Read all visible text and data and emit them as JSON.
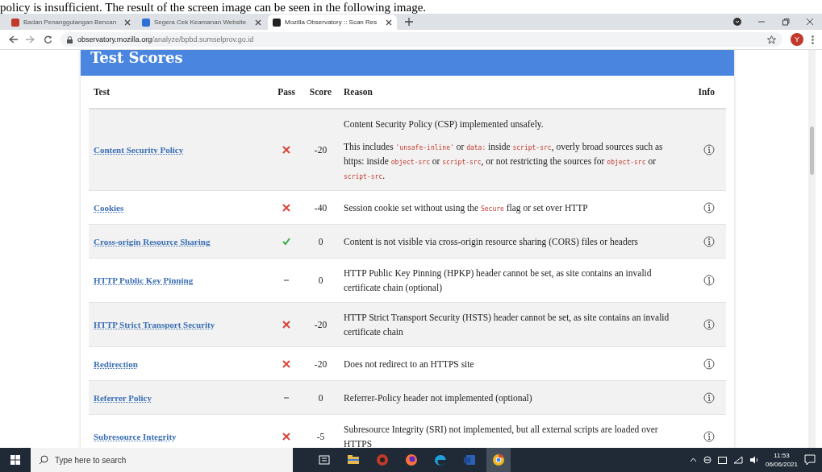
{
  "document_text": "policy is insufficient. The result of the screen image can be seen in the following image.",
  "tabs": [
    {
      "title": "Badan Penanggulangan Bencan",
      "color": "#c0392b",
      "selected": false
    },
    {
      "title": "Segera Cek Keamanan Website",
      "color": "#2f6fd6",
      "selected": false
    },
    {
      "title": "Mozilla Observatory :: Scan Res",
      "color": "#222222",
      "selected": true
    }
  ],
  "address_bar": {
    "host": "observatory.mozilla.org",
    "path": "/analyze/bpbd.sumselprov.go.id"
  },
  "profile_initial": "Y",
  "section_title": "Test Scores",
  "columns": [
    "Test",
    "Pass",
    "Score",
    "Reason",
    "Info"
  ],
  "rows": [
    {
      "test": "Content Security Policy",
      "kind": "fail",
      "score": "-20",
      "reason": [
        [
          {
            "kind": "text",
            "text": "Content Security Policy (CSP) implemented unsafely."
          }
        ],
        [
          {
            "kind": "text",
            "text": "This includes "
          },
          {
            "kind": "code",
            "text": "'unsafe-inline'"
          },
          {
            "kind": "text",
            "text": " or "
          },
          {
            "kind": "code",
            "text": "data:"
          },
          {
            "kind": "text",
            "text": " inside "
          },
          {
            "kind": "code",
            "text": "script-src"
          },
          {
            "kind": "text",
            "text": ", overly broad sources such as https: inside "
          },
          {
            "kind": "code",
            "text": "object-src"
          },
          {
            "kind": "text",
            "text": " or "
          },
          {
            "kind": "code",
            "text": "script-src"
          },
          {
            "kind": "text",
            "text": ", or not restricting the sources for "
          },
          {
            "kind": "code",
            "text": "object-src"
          },
          {
            "kind": "text",
            "text": " or "
          },
          {
            "kind": "code",
            "text": "script-src"
          },
          {
            "kind": "text",
            "text": "."
          }
        ]
      ]
    },
    {
      "test": "Cookies",
      "kind": "fail",
      "score": "-40",
      "reason": [
        [
          {
            "kind": "text",
            "text": "Session cookie set without using the "
          },
          {
            "kind": "code",
            "text": "Secure"
          },
          {
            "kind": "text",
            "text": " flag or set over HTTP"
          }
        ]
      ]
    },
    {
      "test": "Cross-origin Resource Sharing",
      "kind": "pass",
      "score": "0",
      "reason": [
        [
          {
            "kind": "text",
            "text": "Content is not visible via cross-origin resource sharing (CORS) files or headers"
          }
        ]
      ]
    },
    {
      "test": "HTTP Public Key Pinning",
      "kind": "na",
      "score": "0",
      "reason": [
        [
          {
            "kind": "text",
            "text": "HTTP Public Key Pinning (HPKP) header cannot be set, as site contains an invalid certificate chain (optional)"
          }
        ]
      ]
    },
    {
      "test": "HTTP Strict Transport Security",
      "kind": "fail",
      "score": "-20",
      "reason": [
        [
          {
            "kind": "text",
            "text": "HTTP Strict Transport Security (HSTS) header cannot be set, as site contains an invalid certificate chain"
          }
        ]
      ]
    },
    {
      "test": "Redirection",
      "kind": "fail",
      "score": "-20",
      "reason": [
        [
          {
            "kind": "text",
            "text": "Does not redirect to an HTTPS site"
          }
        ]
      ]
    },
    {
      "test": "Referrer Policy",
      "kind": "na",
      "score": "0",
      "reason": [
        [
          {
            "kind": "text",
            "text": "Referrer-Policy header not implemented (optional)"
          }
        ]
      ]
    },
    {
      "test": "Subresource Integrity",
      "kind": "fail",
      "score": "-5",
      "reason": [
        [
          {
            "kind": "text",
            "text": "Subresource Integrity (SRI) not implemented, but all external scripts are loaded over HTTPS"
          }
        ]
      ]
    }
  ],
  "taskbar": {
    "search_placeholder": "Type here to search",
    "time": "11:53",
    "date": "06/06/2021"
  }
}
